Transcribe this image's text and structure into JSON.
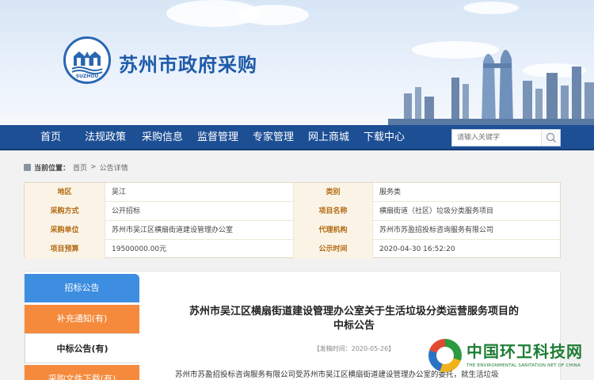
{
  "header": {
    "logo_caption": "SUZHOU",
    "site_title": "苏州市政府采购"
  },
  "nav": {
    "items": [
      "首页",
      "法规政策",
      "采购信息",
      "监督管理",
      "专家管理",
      "网上商城",
      "下载中心"
    ],
    "search_placeholder": "请输入关键字"
  },
  "breadcrumb": {
    "label": "当前位置：",
    "home": "首页",
    "separator": ">",
    "current": "公告详情"
  },
  "info": {
    "rows": [
      [
        {
          "label": "地区",
          "value": "吴江"
        },
        {
          "label": "类别",
          "value": "服务类"
        }
      ],
      [
        {
          "label": "采购方式",
          "value": "公开招标"
        },
        {
          "label": "项目名称",
          "value": "横扇街道（社区）垃圾分类服务项目"
        }
      ],
      [
        {
          "label": "采购单位",
          "value": "苏州市吴江区横扇街道建设管理办公室"
        },
        {
          "label": "代理机构",
          "value": "苏州市苏盈招投标咨询服务有限公司"
        }
      ],
      [
        {
          "label": "项目预算",
          "value": "19500000.00元"
        },
        {
          "label": "公示时间",
          "value": "2020-04-30 16:52:20"
        }
      ]
    ]
  },
  "tabs": [
    "招标公告",
    "补充通知(有)",
    "中标公告(有)",
    "采购文件下载(有)"
  ],
  "notice": {
    "title_line1": "苏州市吴江区横扇街道建设管理办公室关于生活垃圾分类运营服务项目的",
    "title_line2": "中标公告",
    "date": "【发稿时间：2020-05-26】",
    "body": "苏州市苏盈招投标咨询服务有限公司受苏州市吴江区横扇街道建设管理办公室的委托，就生活垃圾"
  },
  "watermark": {
    "title": "中国环卫科技网",
    "subtitle": "THE ENVIRONMENTAL SANITATION NET OF CHINA"
  },
  "colors": {
    "nav_bg": "#1d4f95",
    "label_text": "#b26a12",
    "label_bg": "#fbf4e6",
    "tab_blue": "#3d8de0",
    "tab_orange": "#f58a3c",
    "watermark_green": "#1e7d35"
  },
  "icons": {
    "search": "search-icon",
    "home": "home-icon",
    "logo": "suzhou-emblem-icon",
    "watermark": "recycle-drop-icon"
  }
}
